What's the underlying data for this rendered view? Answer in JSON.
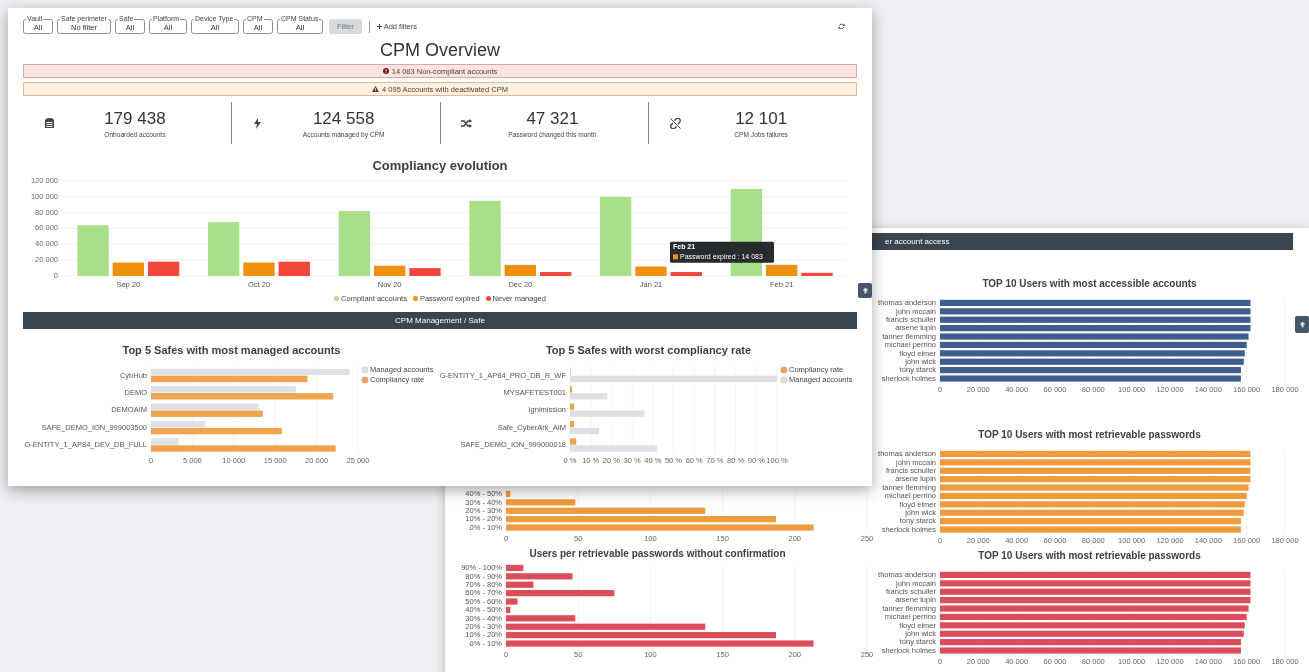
{
  "front_window": {
    "filters": [
      {
        "label": "Vault",
        "value": "All"
      },
      {
        "label": "Safe perimeter",
        "value": "No filter"
      },
      {
        "label": "Safe",
        "value": "All"
      },
      {
        "label": "Platform",
        "value": "All"
      },
      {
        "label": "Device Type",
        "value": "All"
      },
      {
        "label": "CPM",
        "value": "All"
      },
      {
        "label": "CPM Status",
        "value": "All"
      }
    ],
    "filter_button": {
      "label": "Filter",
      "disabled": true
    },
    "add_filters": "Add filters",
    "title": "CPM Overview",
    "alerts": [
      {
        "kind": "error",
        "text": "14 083 Non-compliant accounts"
      },
      {
        "kind": "warning",
        "text": "4 095 Accounts with deactivated CPM"
      }
    ],
    "stats": [
      {
        "value": "179 438",
        "label": "Onboarded accounts"
      },
      {
        "value": "124 558",
        "label": "Accounts managed by CPM"
      },
      {
        "value": "47 321",
        "label": "Password changed this month"
      },
      {
        "value": "12 101",
        "label": "CPM Jobs failures"
      }
    ],
    "compliancy": {
      "title": "Compliancy evolution",
      "chart_data": {
        "type": "bar",
        "orientation": "vertical",
        "grid": true,
        "legend": "bottom",
        "categories": [
          "Sep 20",
          "Oct 20",
          "Nov 20",
          "Dec 20",
          "Jan 21",
          "Feb 21"
        ],
        "series": [
          {
            "name": "Compliant accounts",
            "color": "#a8e08a",
            "values": [
              64000,
              68000,
              82000,
              95000,
              100000,
              110000
            ]
          },
          {
            "name": "Password expired",
            "color": "#f0900f",
            "values": [
              17000,
              17000,
              13000,
              14000,
              12000,
              14083
            ]
          },
          {
            "name": "Never managed",
            "color": "#f2473b",
            "values": [
              18000,
              18000,
              10000,
              5000,
              5000,
              4000
            ]
          }
        ],
        "ylim": [
          0,
          120000
        ],
        "yticks": [
          {
            "value": 0,
            "label": "0"
          },
          {
            "value": 20000,
            "label": "20 000"
          },
          {
            "value": 40000,
            "label": "40 000"
          },
          {
            "value": 60000,
            "label": "60 000"
          },
          {
            "value": 80000,
            "label": "80 000"
          },
          {
            "value": 100000,
            "label": "100 000"
          },
          {
            "value": 120000,
            "label": "120 000"
          }
        ]
      },
      "tooltip": {
        "title": "Feb 21",
        "text": "Password expired : 14 083"
      }
    },
    "section": "CPM Management / Safe",
    "safe_charts": [
      {
        "title": "Top 5 Safes with most managed accounts",
        "chart_data": {
          "type": "bar",
          "orientation": "horizontal",
          "grid": true,
          "legend": "right",
          "categories": [
            "CybHub",
            "DEMO",
            "DEMOAIM",
            "SAFE_DEMO_ION_999003500",
            "G-ENTITY_1_AP84_DEV_DB_FULL"
          ],
          "series": [
            {
              "name": "Managed accounts",
              "color": "#dde1e6",
              "values": [
                24000,
                17500,
                13000,
                6500,
                3300
              ]
            },
            {
              "name": "Compliancy rate",
              "color": "#f0a450",
              "values": [
                18900,
                22000,
                13500,
                15800,
                22300
              ]
            }
          ],
          "xlim": [
            0,
            25000
          ],
          "xticks": [
            {
              "value": 0,
              "label": "0"
            },
            {
              "value": 5000,
              "label": "5 000"
            },
            {
              "value": 10000,
              "label": "10 000"
            },
            {
              "value": 15000,
              "label": "15 000"
            },
            {
              "value": 20000,
              "label": "20 000"
            },
            {
              "value": 25000,
              "label": "25 000"
            }
          ]
        }
      },
      {
        "title": "Top 5 Safes with worst compliancy rate",
        "chart_data": {
          "type": "bar",
          "orientation": "horizontal",
          "grid": true,
          "legend": "right",
          "categories": [
            "G-ENTITY_1_AP84_PRO_DB_R_WF",
            "MYSAFETEST001",
            "Ignimission",
            "Safe_CyberArk_AIM",
            "SAFE_DEMO_ION_999000018"
          ],
          "series": [
            {
              "name": "Compliancy rate",
              "color": "#f0a450",
              "values": [
                0.3,
                1,
                2,
                2,
                3
              ]
            },
            {
              "name": "Managed accounts",
              "color": "#dde1e6",
              "values": [
                100,
                18,
                36,
                14,
                42
              ]
            }
          ],
          "xlim": [
            0,
            100
          ],
          "xticks": [
            {
              "value": 0,
              "label": "0 %"
            },
            {
              "value": 10,
              "label": "10 %"
            },
            {
              "value": 20,
              "label": "20 %"
            },
            {
              "value": 30,
              "label": "30 %"
            },
            {
              "value": 40,
              "label": "40 %"
            },
            {
              "value": 50,
              "label": "50 %"
            },
            {
              "value": 60,
              "label": "60 %"
            },
            {
              "value": 70,
              "label": "70 %"
            },
            {
              "value": 80,
              "label": "80 %"
            },
            {
              "value": 90,
              "label": "90 %"
            },
            {
              "value": 100,
              "label": "100 %"
            }
          ]
        }
      }
    ]
  },
  "back_window": {
    "header": "er account access",
    "left_charts": [
      {
        "chart_data": {
          "type": "bar",
          "orientation": "horizontal",
          "grid": true,
          "categories": [
            "40% - 50%",
            "30% - 40%",
            "20% - 30%",
            "10% - 20%",
            "0% - 10%"
          ],
          "series": [
            {
              "color": "#ef9a3c",
              "values": [
                3,
                48,
                138,
                187,
                213
              ]
            }
          ],
          "xlim": [
            0,
            250
          ],
          "xticks": [
            0,
            50,
            100,
            150,
            200,
            250
          ]
        }
      },
      {
        "title": "Users per retrievable passwords without confirmation",
        "chart_data": {
          "type": "bar",
          "orientation": "horizontal",
          "grid": true,
          "categories": [
            "90% - 100%",
            "80% - 90%",
            "70% - 80%",
            "60% - 70%",
            "50% - 60%",
            "40% - 50%",
            "30% - 40%",
            "20% - 30%",
            "10% - 20%",
            "0% - 10%"
          ],
          "series": [
            {
              "color": "#dc4d5c",
              "values": [
                12,
                46,
                19,
                75,
                8,
                3,
                48,
                138,
                187,
                213
              ]
            }
          ],
          "xlim": [
            0,
            250
          ],
          "xticks": [
            0,
            50,
            100,
            150,
            200,
            250
          ]
        }
      }
    ],
    "right_charts": [
      {
        "title": "TOP 10 Users with most accessible accounts",
        "chart_data": {
          "type": "bar",
          "orientation": "horizontal",
          "grid": true,
          "categories": [
            "thomas anderson",
            "john mccain",
            "francis schuller",
            "arsene lupin",
            "tanner flemming",
            "michael perrino",
            "floyd elmer",
            "john wick",
            "tony starck",
            "sherlock holmes"
          ],
          "series": [
            {
              "color": "#3d5f8e",
              "values": [
                162000,
                162000,
                162000,
                162000,
                161000,
                160000,
                159000,
                158500,
                157000,
                157000
              ]
            }
          ],
          "xlim": [
            0,
            180000
          ],
          "xticks": [
            {
              "value": 0,
              "label": "0"
            },
            {
              "value": 20000,
              "label": "20 000"
            },
            {
              "value": 40000,
              "label": "40 000"
            },
            {
              "value": 60000,
              "label": "60 000"
            },
            {
              "value": 80000,
              "label": "80 000"
            },
            {
              "value": 100000,
              "label": "100 000"
            },
            {
              "value": 120000,
              "label": "120 000"
            },
            {
              "value": 140000,
              "label": "140 000"
            },
            {
              "value": 160000,
              "label": "160 000"
            },
            {
              "value": 180000,
              "label": "180 000"
            }
          ]
        }
      },
      {
        "title": "TOP 10 Users with most retrievable passwords",
        "chart_data": {
          "type": "bar",
          "orientation": "horizontal",
          "grid": true,
          "categories": [
            "thomas anderson",
            "john mccain",
            "francis schuller",
            "arsene lupin",
            "tanner flemming",
            "michael perrino",
            "floyd elmer",
            "john wick",
            "tony starck",
            "sherlock holmes"
          ],
          "series": [
            {
              "color": "#ef9a3c",
              "values": [
                162000,
                162000,
                162000,
                162000,
                161000,
                160000,
                159000,
                158500,
                157000,
                157000
              ]
            }
          ],
          "xlim": [
            0,
            180000
          ],
          "xticks": [
            {
              "value": 0,
              "label": "0"
            },
            {
              "value": 20000,
              "label": "20 000"
            },
            {
              "value": 40000,
              "label": "40 000"
            },
            {
              "value": 60000,
              "label": "60 000"
            },
            {
              "value": 80000,
              "label": "80 000"
            },
            {
              "value": 100000,
              "label": "100 000"
            },
            {
              "value": 120000,
              "label": "120 000"
            },
            {
              "value": 140000,
              "label": "140 000"
            },
            {
              "value": 160000,
              "label": "160 000"
            },
            {
              "value": 180000,
              "label": "180 000"
            }
          ]
        }
      },
      {
        "title": "TOP 10 Users with most retrievable passwords",
        "chart_data": {
          "type": "bar",
          "orientation": "horizontal",
          "grid": true,
          "categories": [
            "thomas anderson",
            "john mccain",
            "francis schuller",
            "arsene lupin",
            "tanner flemming",
            "michael perrino",
            "floyd elmer",
            "john wick",
            "tony starck",
            "sherlock holmes"
          ],
          "series": [
            {
              "color": "#dc4d5c",
              "values": [
                162000,
                162000,
                162000,
                162000,
                161000,
                160000,
                159000,
                158500,
                157000,
                157000
              ]
            }
          ],
          "xlim": [
            0,
            180000
          ],
          "xticks": [
            {
              "value": 0,
              "label": "0"
            },
            {
              "value": 20000,
              "label": "20 000"
            },
            {
              "value": 40000,
              "label": "40 000"
            },
            {
              "value": 60000,
              "label": "60 000"
            },
            {
              "value": 80000,
              "label": "80 000"
            },
            {
              "value": 100000,
              "label": "100 000"
            },
            {
              "value": 120000,
              "label": "120 000"
            },
            {
              "value": 140000,
              "label": "140 000"
            },
            {
              "value": 160000,
              "label": "160 000"
            },
            {
              "value": 180000,
              "label": "180 000"
            }
          ]
        }
      }
    ]
  }
}
